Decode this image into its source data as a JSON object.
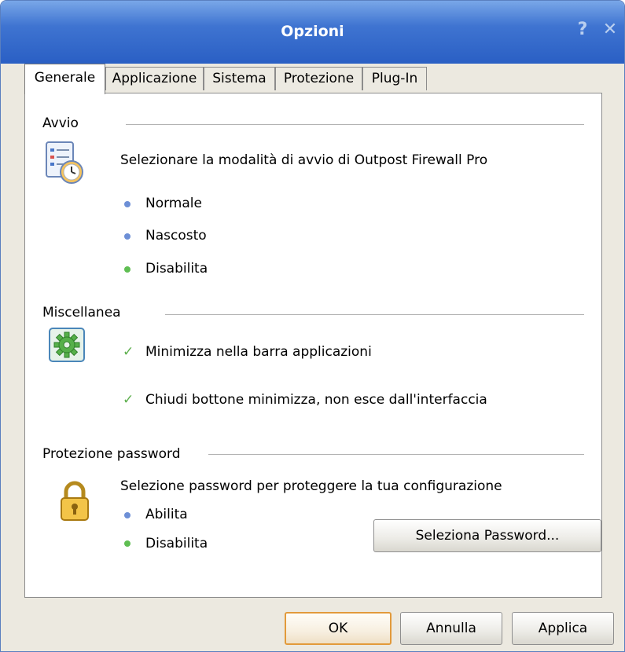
{
  "window": {
    "title": "Opzioni",
    "help_glyph": "?",
    "close_glyph": "✕"
  },
  "tabs": [
    {
      "label": "Generale",
      "active": true
    },
    {
      "label": "Applicazione",
      "active": false
    },
    {
      "label": "Sistema",
      "active": false
    },
    {
      "label": "Protezione",
      "active": false
    },
    {
      "label": "Plug-In",
      "active": false
    }
  ],
  "startup": {
    "heading": "Avvio",
    "description": "Selezionare la modalità di avvio di Outpost Firewall Pro",
    "options": [
      {
        "label": "Normale",
        "state": "blue"
      },
      {
        "label": "Nascosto",
        "state": "blue"
      },
      {
        "label": "Disabilita",
        "state": "green"
      }
    ]
  },
  "misc": {
    "heading": "Miscellanea",
    "options": [
      {
        "label": "Minimizza nella barra applicazioni"
      },
      {
        "label": "Chiudi bottone minimizza, non esce dall'interfaccia"
      }
    ]
  },
  "password": {
    "heading": "Protezione password",
    "description": "Selezione password per proteggere la tua configurazione",
    "options": [
      {
        "label": "Abilita",
        "state": "blue"
      },
      {
        "label": "Disabilita",
        "state": "green"
      }
    ],
    "set_button": "Seleziona Password..."
  },
  "footer": {
    "ok": "OK",
    "cancel": "Annulla",
    "apply": "Applica"
  },
  "colors": {
    "bullet_blue": "#6d8fd6",
    "bullet_green": "#5fbe52",
    "check_green": "#5daf4d",
    "title_blue": "#2a5fc4"
  },
  "icons": {
    "startup": "clock-list-icon",
    "misc": "gear-icon",
    "password": "padlock-icon",
    "check": "checkmark-icon"
  }
}
